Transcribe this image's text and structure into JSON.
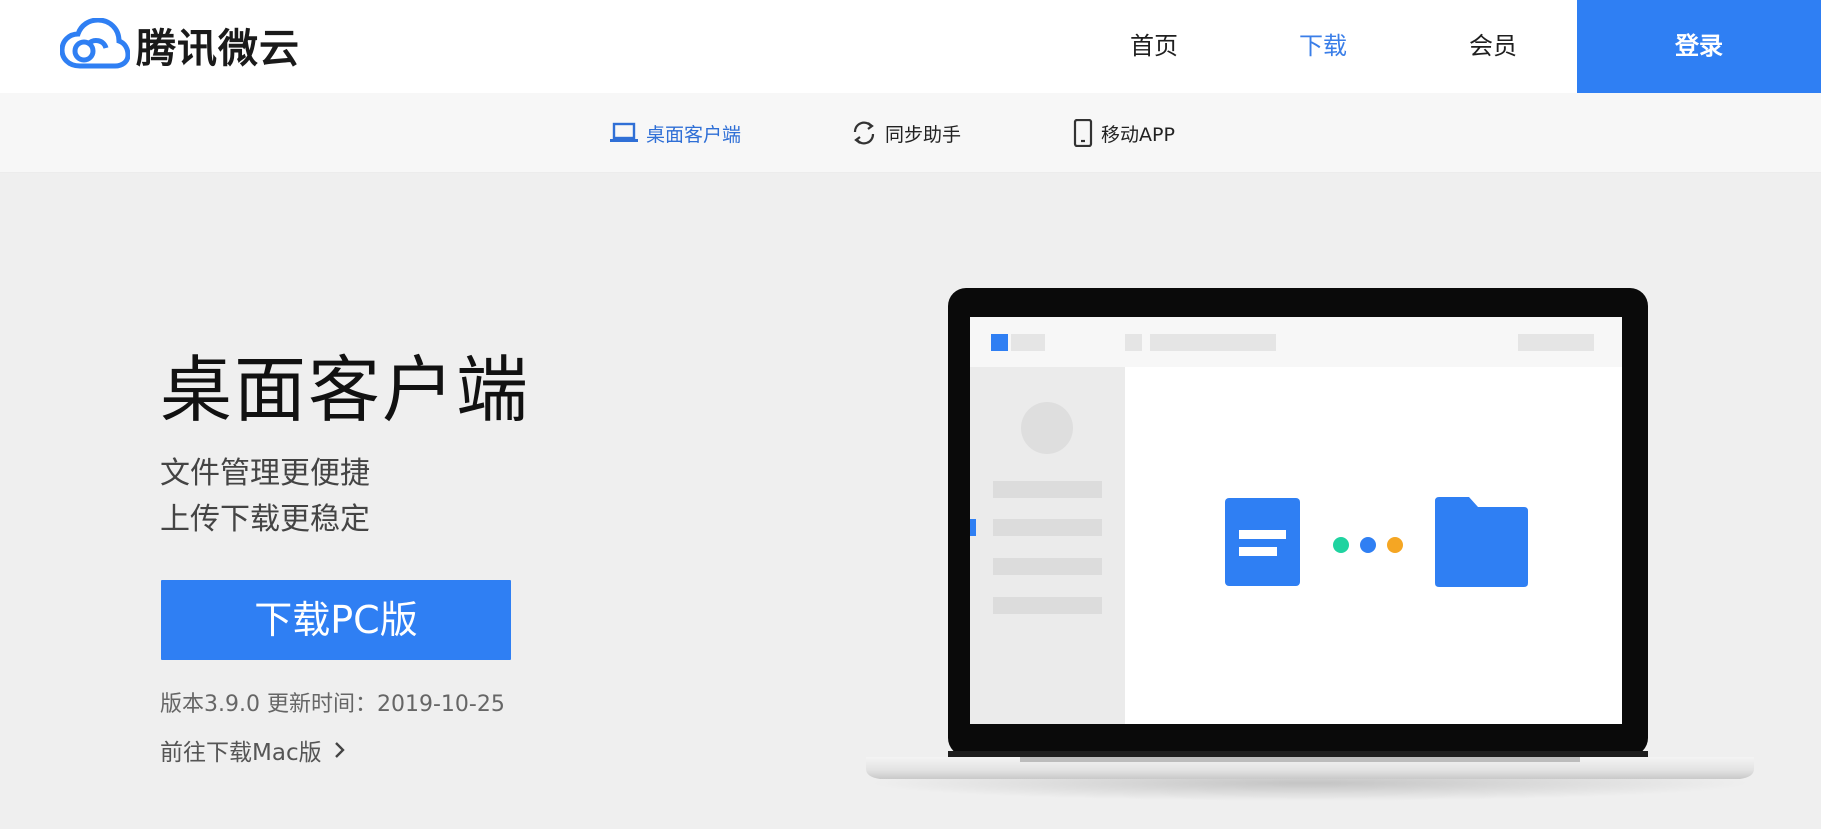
{
  "header": {
    "logo_text": "腾讯微云",
    "nav": [
      {
        "label": "首页",
        "active": false
      },
      {
        "label": "下载",
        "active": true
      },
      {
        "label": "会员",
        "active": false
      }
    ],
    "login_label": "登录"
  },
  "subnav": {
    "items": [
      {
        "label": "桌面客户端",
        "icon": "laptop-icon",
        "active": true
      },
      {
        "label": "同步助手",
        "icon": "sync-icon",
        "active": false
      },
      {
        "label": "移动APP",
        "icon": "phone-icon",
        "active": false
      }
    ]
  },
  "hero": {
    "title": "桌面客户端",
    "subtitle_line1": "文件管理更便捷",
    "subtitle_line2": "上传下载更稳定",
    "download_label": "下载PC版",
    "version_text": "版本3.9.0 更新时间：2019-10-25",
    "mac_link_label": "前往下载Mac版"
  },
  "colors": {
    "accent": "#2f7ff3",
    "active_text": "#3a7ee8",
    "dot_green": "#1fd3a0",
    "dot_blue": "#2f7ff3",
    "dot_orange": "#f5a623"
  }
}
